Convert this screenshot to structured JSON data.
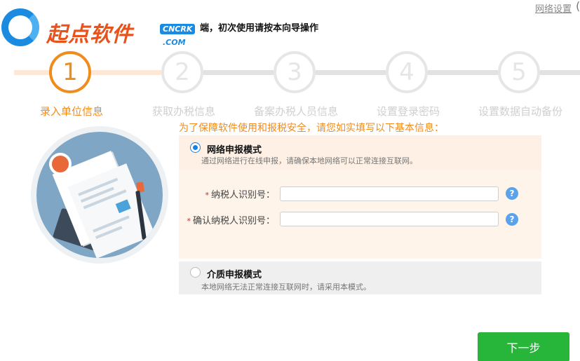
{
  "header": {
    "logo_text": "起点软件",
    "logo_badge": "CNCRK",
    "logo_badge_sub": ".COM",
    "message": "端，初次使用请按本向导操作",
    "network_settings_link": "网络设置",
    "network_settings_glyph": "("
  },
  "steps": [
    {
      "number": "1",
      "label": "录入单位信息",
      "active": true
    },
    {
      "number": "2",
      "label": "获取办税信息",
      "active": false
    },
    {
      "number": "3",
      "label": "备案办税人员信息",
      "active": false
    },
    {
      "number": "4",
      "label": "设置登录密码",
      "active": false
    },
    {
      "number": "5",
      "label": "设置数据自动备份",
      "active": false
    }
  ],
  "form": {
    "prompt": "为了保障软件使用和报税安全，请您如实填写以下基本信息：",
    "online_mode": {
      "title": "网络申报模式",
      "description": "通过网络进行在线申报，请确保本地网络可以正常连接互联网。",
      "selected": true
    },
    "fields": [
      {
        "required_mark": "*",
        "label": "纳税人识别号：",
        "value": "",
        "help": "?"
      },
      {
        "required_mark": "*",
        "label": "确认纳税人识别号：",
        "value": "",
        "help": "?"
      }
    ],
    "media_mode": {
      "title": "介质申报模式",
      "description": "本地网络无法正常连接互联网时，请采用本模式。",
      "selected": false
    }
  },
  "actions": {
    "next_label": "下一步"
  },
  "colors": {
    "accent_orange": "#f08c1c",
    "inactive_gray": "#e6e6e6",
    "primary_green": "#27b63a",
    "radio_blue": "#1b7fe0",
    "help_blue": "#5aa3ec"
  }
}
